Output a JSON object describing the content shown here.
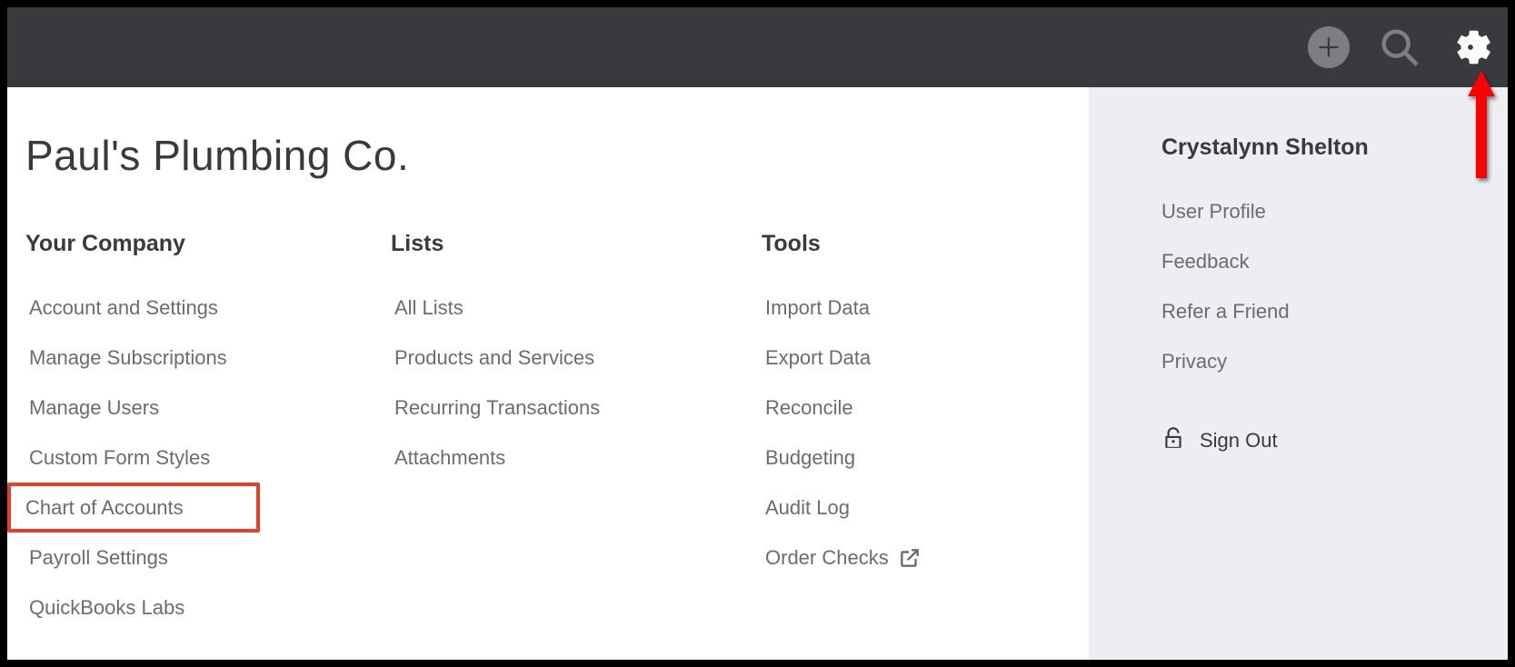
{
  "company_name": "Paul's Plumbing Co.",
  "columns": {
    "your_company": {
      "heading": "Your Company",
      "items": [
        "Account and Settings",
        "Manage Subscriptions",
        "Manage Users",
        "Custom Form Styles",
        "Chart of Accounts",
        "Payroll Settings",
        "QuickBooks Labs"
      ]
    },
    "lists": {
      "heading": "Lists",
      "items": [
        "All Lists",
        "Products and Services",
        "Recurring Transactions",
        "Attachments"
      ]
    },
    "tools": {
      "heading": "Tools",
      "items": [
        "Import Data",
        "Export Data",
        "Reconcile",
        "Budgeting",
        "Audit Log",
        "Order Checks"
      ]
    }
  },
  "user": {
    "name": "Crystalynn Shelton",
    "items": [
      "User Profile",
      "Feedback",
      "Refer a Friend",
      "Privacy"
    ],
    "sign_out": "Sign Out"
  }
}
